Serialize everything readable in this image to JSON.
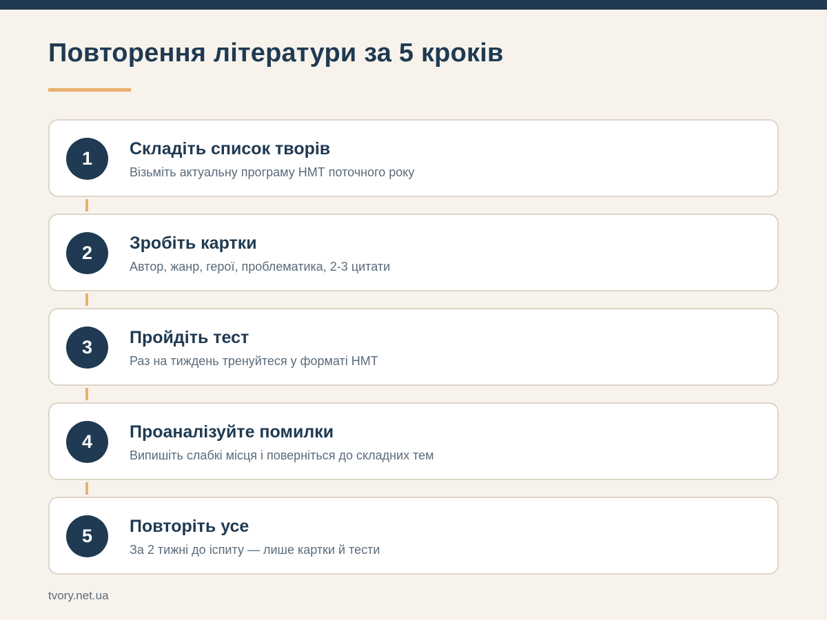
{
  "header": {
    "title": "Повторення літератури за 5 кроків"
  },
  "colors": {
    "primary": "#1f3a52",
    "accent": "#e8b06a",
    "background": "#f7f3ec",
    "card": "#ffffff",
    "card_border": "#ddd5c7",
    "muted_text": "#5b6b7b"
  },
  "steps": [
    {
      "number": "1",
      "title": "Складіть список творів",
      "description": "Візьміть актуальну програму НМТ поточного року"
    },
    {
      "number": "2",
      "title": "Зробіть картки",
      "description": "Автор, жанр, герої, проблематика, 2-3 цитати"
    },
    {
      "number": "3",
      "title": "Пройдіть тест",
      "description": "Раз на тиждень тренуйтеся у форматі НМТ"
    },
    {
      "number": "4",
      "title": "Проаналізуйте помилки",
      "description": "Випишіть слабкі місця і поверніться до складних тем"
    },
    {
      "number": "5",
      "title": "Повторіть усе",
      "description": "За 2 тижні до іспиту — лише картки й тести"
    }
  ],
  "footer": {
    "source": "tvory.net.ua"
  }
}
